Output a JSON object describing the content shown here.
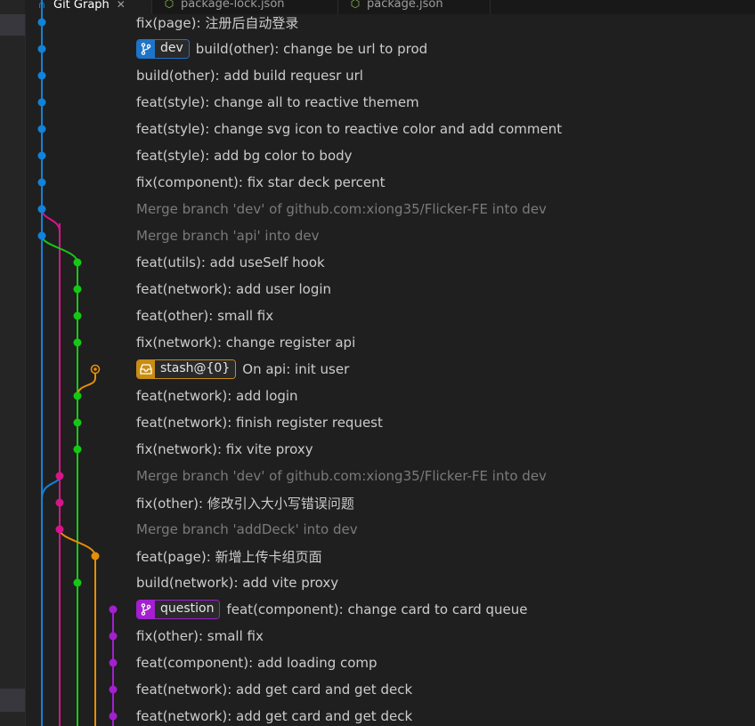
{
  "tabs": [
    {
      "label": "Git Graph",
      "icon": "git-graph-icon",
      "active": true
    },
    {
      "label": "package-lock.json",
      "icon": "json-icon",
      "active": false
    },
    {
      "label": "package.json",
      "icon": "json-icon",
      "active": false
    }
  ],
  "colors": {
    "lane_blue": "#1183d9",
    "lane_magenta": "#d6158a",
    "lane_green": "#14c914",
    "lane_orange": "#e58e0a",
    "lane_purple": "#a31fd0",
    "text": "#cccccc",
    "merge_text": "#7a7a7a",
    "background": "#1f1f1f"
  },
  "commits": [
    {
      "message": "fix(page): 注册后自动登录",
      "lane": 0
    },
    {
      "message": "build(other): change be url to prod",
      "lane": 0,
      "badge": {
        "type": "branch",
        "label": "dev",
        "color": "#1e74c8",
        "icon": "branch-icon"
      }
    },
    {
      "message": "build(other): add build requesr url",
      "lane": 0
    },
    {
      "message": "feat(style): change all to reactive themem",
      "lane": 0
    },
    {
      "message": "feat(style): change svg icon to reactive color and add comment",
      "lane": 0
    },
    {
      "message": "feat(style): add bg color to body",
      "lane": 0
    },
    {
      "message": "fix(component): fix star deck percent",
      "lane": 0
    },
    {
      "message": "Merge branch 'dev' of github.com:xiong35/Flicker-FE into dev",
      "lane": 0,
      "merge": true
    },
    {
      "message": "Merge branch 'api' into dev",
      "lane": 0,
      "merge": true
    },
    {
      "message": "feat(utils): add useSelf hook",
      "lane": 2
    },
    {
      "message": "feat(network): add user login",
      "lane": 2
    },
    {
      "message": "feat(other): small fix",
      "lane": 2
    },
    {
      "message": "fix(network): change register api",
      "lane": 2
    },
    {
      "message": "On api: init user",
      "lane": 3,
      "badge": {
        "type": "stash",
        "label": "stash@{0}",
        "color": "#c98d14",
        "icon": "stash-icon"
      }
    },
    {
      "message": "feat(network): add login",
      "lane": 2
    },
    {
      "message": "feat(network): finish register request",
      "lane": 2
    },
    {
      "message": "fix(network): fix vite proxy",
      "lane": 2
    },
    {
      "message": "Merge branch 'dev' of github.com:xiong35/Flicker-FE into dev",
      "lane": 1,
      "merge": true
    },
    {
      "message": "fix(other): 修改引入大小写错误问题",
      "lane": 1
    },
    {
      "message": "Merge branch 'addDeck' into dev",
      "lane": 1,
      "merge": true
    },
    {
      "message": "feat(page): 新增上传卡组页面",
      "lane": 3
    },
    {
      "message": "build(network): add vite proxy",
      "lane": 2
    },
    {
      "message": "feat(component): change card to card queue",
      "lane": 4,
      "badge": {
        "type": "branch",
        "label": "question",
        "color": "#a31fd0",
        "icon": "branch-icon"
      }
    },
    {
      "message": "fix(other): small fix",
      "lane": 4
    },
    {
      "message": "feat(component): add loading comp",
      "lane": 4
    },
    {
      "message": "feat(network): add get card and get deck",
      "lane": 4
    },
    {
      "message": "feat(network): add get card and get deck",
      "lane": 4
    }
  ]
}
